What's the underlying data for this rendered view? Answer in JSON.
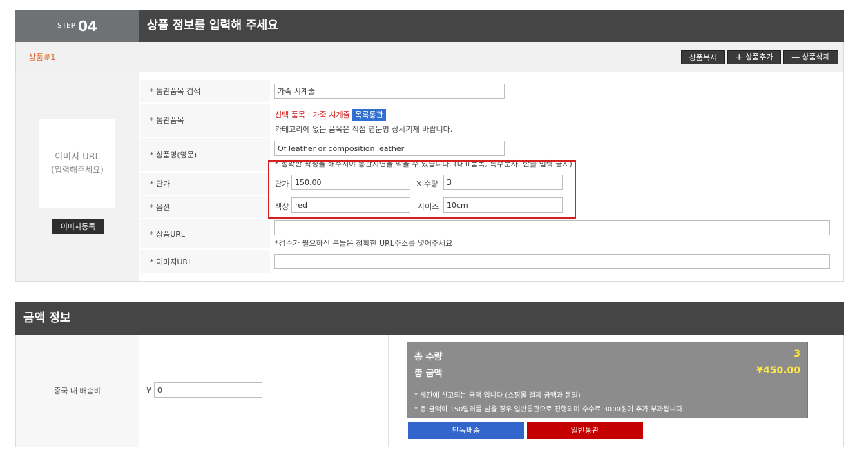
{
  "step": {
    "label": "STEP",
    "number": "04",
    "title": "상품 정보를 입력해 주세요"
  },
  "product": {
    "name": "상품#1",
    "buttons": {
      "copy": "상품복사",
      "add": "상품추가",
      "delete": "상품삭제"
    }
  },
  "image": {
    "placeholder_line1": "이미지 URL",
    "placeholder_line2": "(입력해주세요)",
    "register": "이미지등록"
  },
  "form": {
    "search": {
      "label": "* 통관품목 검색",
      "value": "가죽 시계줄"
    },
    "category": {
      "label": "* 통관품목",
      "selected": "선택 품목 : 가죽 시계줄",
      "tag": "목록통관",
      "note": "카테고리에 없는 품목은 직접 영문명 상세기재 바랍니다."
    },
    "name_en": {
      "label": "* 상품명(영문)",
      "value": "Of leather or composition leather",
      "note": "* 정확한 작성을 해주셔야 통관지연을 막을 수 있습니다. (대표품목, 특수문자, 한글 입력 금지)"
    },
    "price": {
      "label": "* 단가",
      "price_label": "단가",
      "price_value": "150.00",
      "qty_label": "X 수량",
      "qty_value": "3"
    },
    "option": {
      "label": "* 옵션",
      "color_label": "색상",
      "color_value": "red",
      "size_label": "사이즈",
      "size_value": "10cm"
    },
    "url": {
      "label": "* 상품URL",
      "value": "",
      "note": "*검수가 필요하신 분들은 정확한 URL주소를 넣어주세요"
    },
    "image_url": {
      "label": "* 이미지URL",
      "value": ""
    }
  },
  "amount": {
    "title": "금액 정보",
    "shipping_label": "중국 내 배송비",
    "currency": "¥",
    "shipping_value": "0",
    "total_qty_label": "총 수량",
    "total_qty": "3",
    "total_amount_label": "총 금액",
    "total_amount": "¥450.00",
    "note1": "* 세관에 신고되는 금액 입니다 (쇼핑몰 결제 금액과 동일)",
    "note2": "* 총 금액이 150달러를 넘을 경우 일반통관으로 진행되며 수수료 3000원이 추가 부과됩니다.",
    "btn_single": "단독배송",
    "btn_general": "일반통관"
  },
  "colors": {
    "header_bg": "#454545",
    "accent_orange": "#e06a2b",
    "highlight_red": "#d62020",
    "btn_blue": "#3366cc",
    "btn_red": "#c40000",
    "total_yellow": "#ffe84a"
  }
}
